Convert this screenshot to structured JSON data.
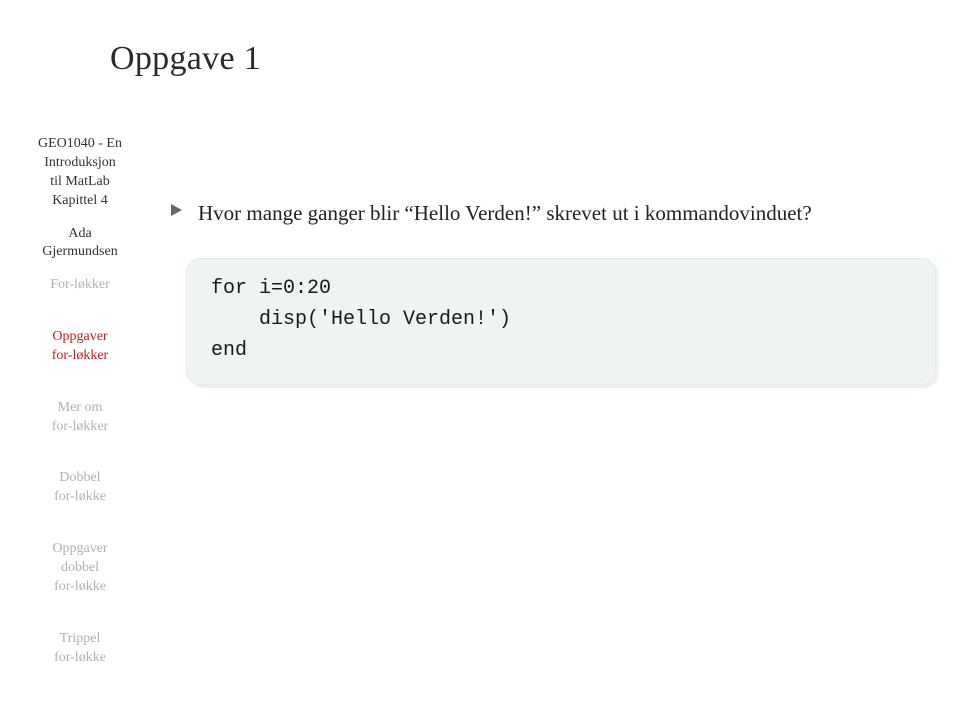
{
  "sidebar": {
    "title": {
      "line1": "GEO1040 - En",
      "line2": "Introduksjon",
      "line3": "til MatLab",
      "line4": "Kapittel 4"
    },
    "author": {
      "line1": "Ada",
      "line2": "Gjermundsen"
    },
    "items": [
      {
        "label": "For-løkker"
      },
      {
        "label": "Oppgaver\nfor-løkker"
      },
      {
        "label": "Mer om\nfor-løkker"
      },
      {
        "label": "Dobbel\nfor-løkke"
      },
      {
        "label": "Oppgaver\ndobbel\nfor-løkke"
      },
      {
        "label": "Trippel\nfor-løkke"
      }
    ]
  },
  "slide": {
    "title": "Oppgave 1",
    "bullet": "Hvor mange ganger blir “Hello Verden!” skrevet ut i kommandovinduet?",
    "code": "for i=0:20\n    disp('Hello Verden!')\nend"
  }
}
